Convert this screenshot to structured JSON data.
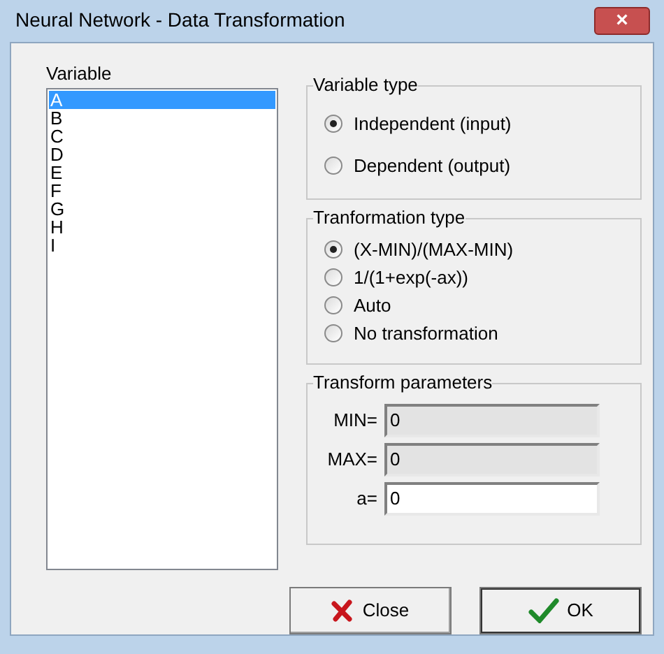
{
  "window": {
    "title": "Neural Network - Data Transformation",
    "close": "×"
  },
  "variable_list": {
    "label": "Variable",
    "items": [
      {
        "label": "A",
        "selected": true
      },
      {
        "label": "B",
        "selected": false
      },
      {
        "label": "C",
        "selected": false
      },
      {
        "label": "D",
        "selected": false
      },
      {
        "label": "E",
        "selected": false
      },
      {
        "label": "F",
        "selected": false
      },
      {
        "label": "G",
        "selected": false
      },
      {
        "label": "H",
        "selected": false
      },
      {
        "label": "I",
        "selected": false
      }
    ]
  },
  "variable_type": {
    "title": "Variable type",
    "options": [
      {
        "label": "Independent (input)",
        "selected": true
      },
      {
        "label": "Dependent (output)",
        "selected": false
      }
    ]
  },
  "transformation_type": {
    "title": "Tranformation type",
    "options": [
      {
        "label": "(X-MIN)/(MAX-MIN)",
        "selected": true
      },
      {
        "label": "1/(1+exp(-ax))",
        "selected": false
      },
      {
        "label": "Auto",
        "selected": false
      },
      {
        "label": "No transformation",
        "selected": false
      }
    ]
  },
  "transform_parameters": {
    "title": "Transform parameters",
    "fields": [
      {
        "label": "MIN=",
        "value": "0",
        "disabled": true
      },
      {
        "label": "MAX=",
        "value": "0",
        "disabled": true
      },
      {
        "label": "a=",
        "value": "0",
        "disabled": false
      }
    ]
  },
  "buttons": [
    {
      "kind": "close",
      "label": "Close"
    },
    {
      "kind": "ok",
      "label": "OK"
    }
  ]
}
